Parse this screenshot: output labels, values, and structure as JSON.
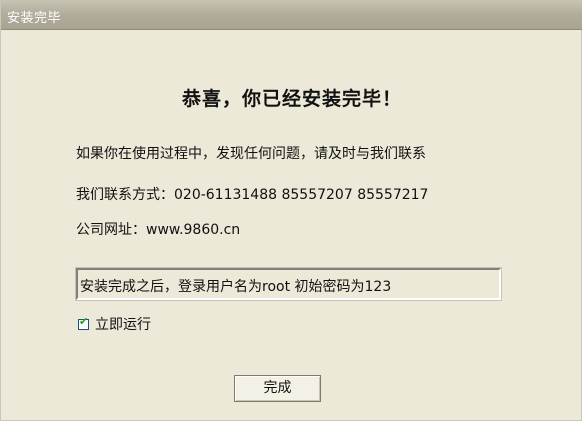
{
  "window": {
    "title": "安装完毕"
  },
  "content": {
    "heading": "恭喜，你已经安装完毕！",
    "line1": "如果你在使用过程中，发现任何问题，请及时与我们联系",
    "line2": "我们联系方式：020-61131488 85557207 85557217",
    "line3": "公司网址：www.9860.cn",
    "notice": "安装完成之后，登录用户名为root 初始密码为123"
  },
  "checkbox": {
    "label": "立即运行",
    "checked": true
  },
  "buttons": {
    "finish_label": "完成"
  }
}
